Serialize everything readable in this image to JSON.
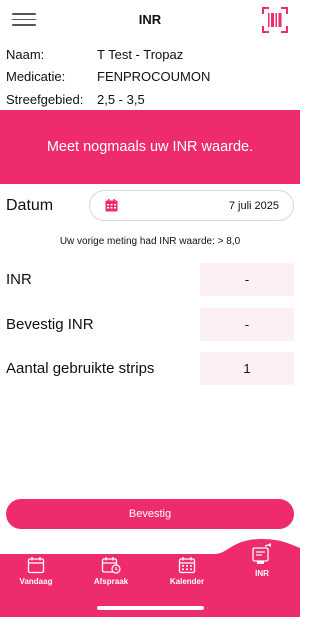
{
  "header": {
    "title": "INR",
    "menu_icon": "hamburger-menu-icon",
    "scan_icon": "barcode-scan-icon",
    "accent_color": "#ee2c6b"
  },
  "patient": {
    "rows": [
      {
        "label": "Naam:",
        "value": "T Test - Tropaz"
      },
      {
        "label": "Medicatie:",
        "value": "FENPROCOUMON"
      },
      {
        "label": "Streefgebied:",
        "value": "2,5 - 3,5"
      }
    ]
  },
  "banner": {
    "text": "Meet nogmaals uw INR waarde."
  },
  "date": {
    "label": "Datum",
    "value": "7 juli 2025",
    "icon": "calendar-icon"
  },
  "previous_measurement": "Uw vorige meting had INR waarde: > 8,0",
  "fields": [
    {
      "label": "INR",
      "value": "-"
    },
    {
      "label": "Bevestig INR",
      "value": "-"
    },
    {
      "label": "Aantal gebruikte strips",
      "value": "1"
    }
  ],
  "confirm_button": "Bevestig",
  "tabs": [
    {
      "label": "Vandaag",
      "icon": "calendar-icon",
      "active": false
    },
    {
      "label": "Afspraak",
      "icon": "calendar-clock-icon",
      "active": false
    },
    {
      "label": "Kalender",
      "icon": "calendar-grid-icon",
      "active": false
    },
    {
      "label": "INR",
      "icon": "inr-meter-icon",
      "active": true
    }
  ]
}
